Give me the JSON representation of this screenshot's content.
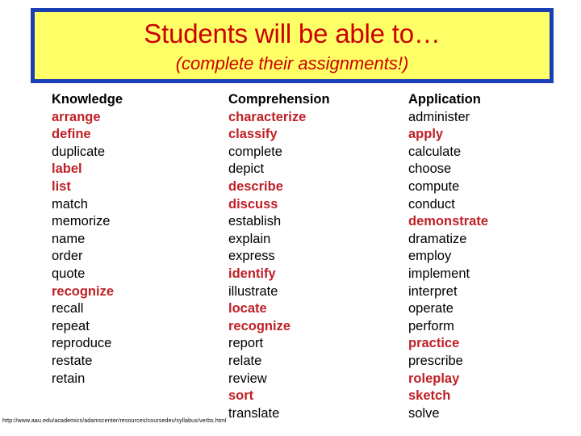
{
  "header": {
    "title": "Students will be able to…",
    "subtitle": "(complete their assignments!)",
    "background_color": "#ffff66",
    "border_color": "#1a3fb5",
    "text_color": "#cc0000"
  },
  "highlight_color": "#bf2026",
  "body_text_color": "#000000",
  "columns": [
    {
      "heading": "Knowledge",
      "items": [
        {
          "label": "arrange",
          "highlighted": true
        },
        {
          "label": "define",
          "highlighted": true
        },
        {
          "label": "duplicate",
          "highlighted": false
        },
        {
          "label": "label",
          "highlighted": true
        },
        {
          "label": "list",
          "highlighted": true
        },
        {
          "label": "match",
          "highlighted": false
        },
        {
          "label": "memorize",
          "highlighted": false
        },
        {
          "label": "name",
          "highlighted": false
        },
        {
          "label": "order",
          "highlighted": false
        },
        {
          "label": "quote",
          "highlighted": false
        },
        {
          "label": "recognize",
          "highlighted": true
        },
        {
          "label": "recall",
          "highlighted": false
        },
        {
          "label": "repeat",
          "highlighted": false
        },
        {
          "label": "reproduce",
          "highlighted": false
        },
        {
          "label": "restate",
          "highlighted": false
        },
        {
          "label": "retain",
          "highlighted": false
        }
      ]
    },
    {
      "heading": "Comprehension",
      "items": [
        {
          "label": "characterize",
          "highlighted": true
        },
        {
          "label": "classify",
          "highlighted": true
        },
        {
          "label": "complete",
          "highlighted": false
        },
        {
          "label": "depict",
          "highlighted": false
        },
        {
          "label": "describe",
          "highlighted": true
        },
        {
          "label": "discuss",
          "highlighted": true
        },
        {
          "label": "establish",
          "highlighted": false
        },
        {
          "label": "explain",
          "highlighted": false
        },
        {
          "label": "express",
          "highlighted": false
        },
        {
          "label": "identify",
          "highlighted": true
        },
        {
          "label": "illustrate",
          "highlighted": false
        },
        {
          "label": "locate",
          "highlighted": true
        },
        {
          "label": "recognize",
          "highlighted": true
        },
        {
          "label": "report",
          "highlighted": false
        },
        {
          "label": "relate",
          "highlighted": false
        },
        {
          "label": "review",
          "highlighted": false
        },
        {
          "label": "sort",
          "highlighted": true
        },
        {
          "label": "translate",
          "highlighted": false
        }
      ]
    },
    {
      "heading": "Application",
      "items": [
        {
          "label": "administer",
          "highlighted": false
        },
        {
          "label": "apply",
          "highlighted": true
        },
        {
          "label": "calculate",
          "highlighted": false
        },
        {
          "label": "choose",
          "highlighted": false
        },
        {
          "label": "compute",
          "highlighted": false
        },
        {
          "label": "conduct",
          "highlighted": false
        },
        {
          "label": "demonstrate",
          "highlighted": true
        },
        {
          "label": "dramatize",
          "highlighted": false
        },
        {
          "label": "employ",
          "highlighted": false
        },
        {
          "label": "implement",
          "highlighted": false
        },
        {
          "label": "interpret",
          "highlighted": false
        },
        {
          "label": "operate",
          "highlighted": false
        },
        {
          "label": "perform",
          "highlighted": false
        },
        {
          "label": "practice",
          "highlighted": true
        },
        {
          "label": "prescribe",
          "highlighted": false
        },
        {
          "label": "roleplay",
          "highlighted": true
        },
        {
          "label": "sketch",
          "highlighted": true
        },
        {
          "label": "solve",
          "highlighted": false
        }
      ]
    }
  ],
  "footer": {
    "source_url": "http://www.aau.edu/academics/adamscenter/resources/coursedev/syllabus/verbs.html"
  }
}
